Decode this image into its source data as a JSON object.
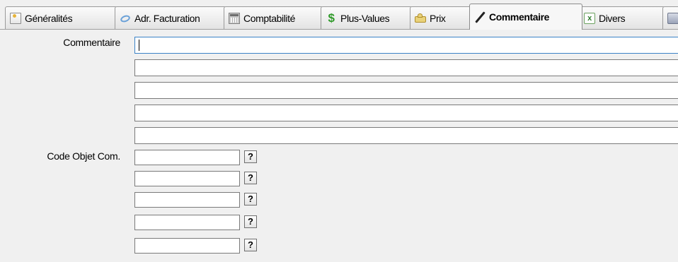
{
  "tabs": [
    {
      "label": "Généralités",
      "icon": "document-icon"
    },
    {
      "label": "Adr. Facturation",
      "icon": "address-icon"
    },
    {
      "label": "Comptabilité",
      "icon": "accounting-icon"
    },
    {
      "label": "Plus-Values",
      "icon": "dollar-icon"
    },
    {
      "label": "Prix",
      "icon": "price-icon"
    },
    {
      "label": "Commentaire",
      "icon": "pen-icon",
      "active": true
    },
    {
      "label": "Divers",
      "icon": "spreadsheet-icon"
    }
  ],
  "form": {
    "comment_label": "Commentaire",
    "comment_lines": [
      "",
      "",
      "",
      "",
      ""
    ],
    "code_label": "Code Objet Com.",
    "code_fields": [
      "",
      "",
      "",
      "",
      ""
    ],
    "help_label": "?"
  }
}
